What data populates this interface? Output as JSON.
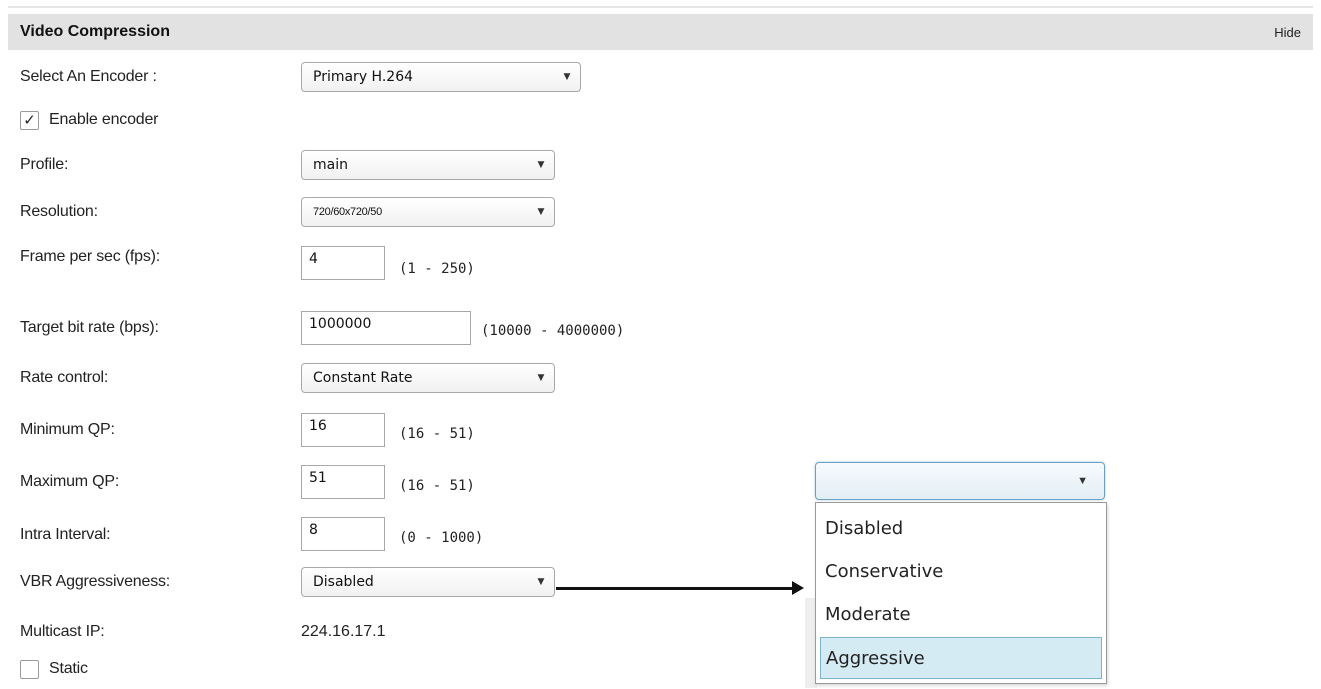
{
  "section": {
    "title": "Video Compression",
    "hide_label": "Hide"
  },
  "fields": {
    "encoder": {
      "label": "Select An Encoder :",
      "value": "Primary H.264"
    },
    "enable_encoder": {
      "label": "Enable encoder",
      "checked": true,
      "check_glyph": "✓"
    },
    "profile": {
      "label": "Profile:",
      "value": "main"
    },
    "resolution": {
      "label": "Resolution:",
      "value": "720/60x720/50"
    },
    "fps": {
      "label": "Frame per sec (fps):",
      "value": "4",
      "range": "(1 - 250)"
    },
    "bitrate": {
      "label": "Target bit rate (bps):",
      "value": "1000000",
      "range": "(10000 - 4000000)"
    },
    "rate_control": {
      "label": "Rate control:",
      "value": "Constant Rate"
    },
    "min_qp": {
      "label": "Minimum QP:",
      "value": "16",
      "range": "(16 - 51)"
    },
    "max_qp": {
      "label": "Maximum QP:",
      "value": "51",
      "range": "(16 - 51)"
    },
    "intra_interval": {
      "label": "Intra Interval:",
      "value": "8",
      "range": "(0 - 1000)"
    },
    "vbr": {
      "label": "VBR Aggressiveness:",
      "value": "Disabled"
    },
    "multicast_ip": {
      "label": "Multicast IP:",
      "value": "224.16.17.1"
    },
    "static": {
      "label": "Static",
      "checked": false
    }
  },
  "vbr_dropdown": {
    "value": "",
    "options": [
      "Disabled",
      "Conservative",
      "Moderate",
      "Aggressive"
    ],
    "highlighted": "Aggressive"
  },
  "icons": {
    "caret": "▼"
  },
  "colors": {
    "header_bg": "#e2e2e2",
    "highlight": "#d4ebf3",
    "focus_border": "#6f9fc2"
  }
}
